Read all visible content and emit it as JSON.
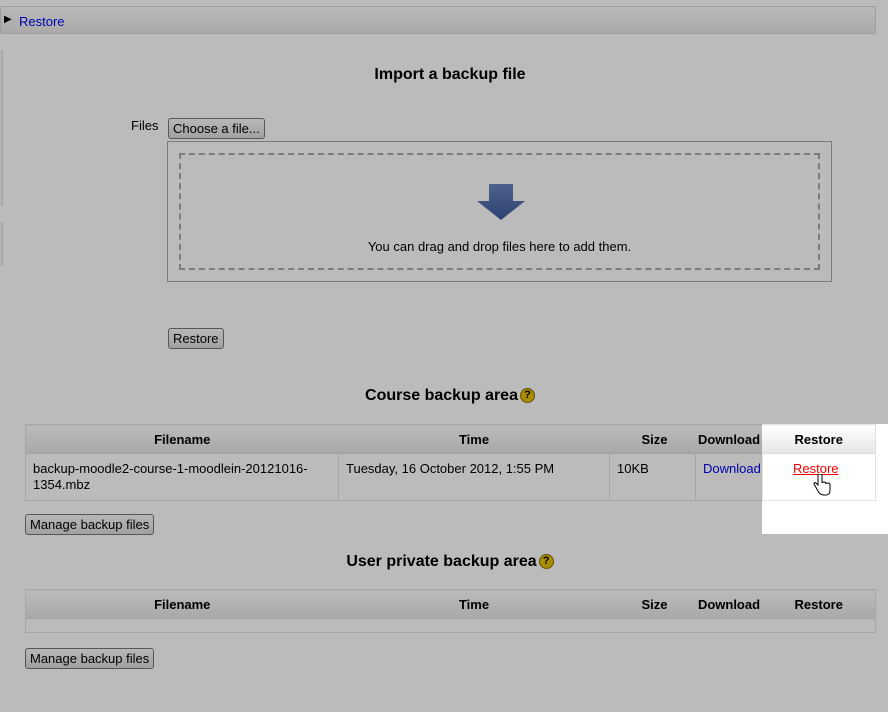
{
  "header": {
    "toggle": "Restore"
  },
  "import": {
    "title": "Import a backup file",
    "files_label": "Files",
    "choose_button": "Choose a file...",
    "drop_message": "You can drag and drop files here to add them.",
    "restore_button": "Restore"
  },
  "course_area": {
    "title": "Course backup area",
    "help": "?",
    "columns": [
      "Filename",
      "Time",
      "Size",
      "Download",
      "Restore"
    ],
    "rows": [
      {
        "filename": "backup-moodle2-course-1-moodlein-20121016-1354.mbz",
        "time": "Tuesday, 16 October 2012, 1:55 PM",
        "size": "10KB",
        "download": "Download",
        "restore": "Restore"
      }
    ],
    "manage_button": "Manage backup files"
  },
  "user_area": {
    "title": "User private backup area",
    "help": "?",
    "columns": [
      "Filename",
      "Time",
      "Size",
      "Download",
      "Restore"
    ],
    "manage_button": "Manage backup files"
  },
  "colors": {
    "link": "#0000ee",
    "highlight_link": "#ee0000",
    "upload_arrow": "#4a66a8"
  }
}
